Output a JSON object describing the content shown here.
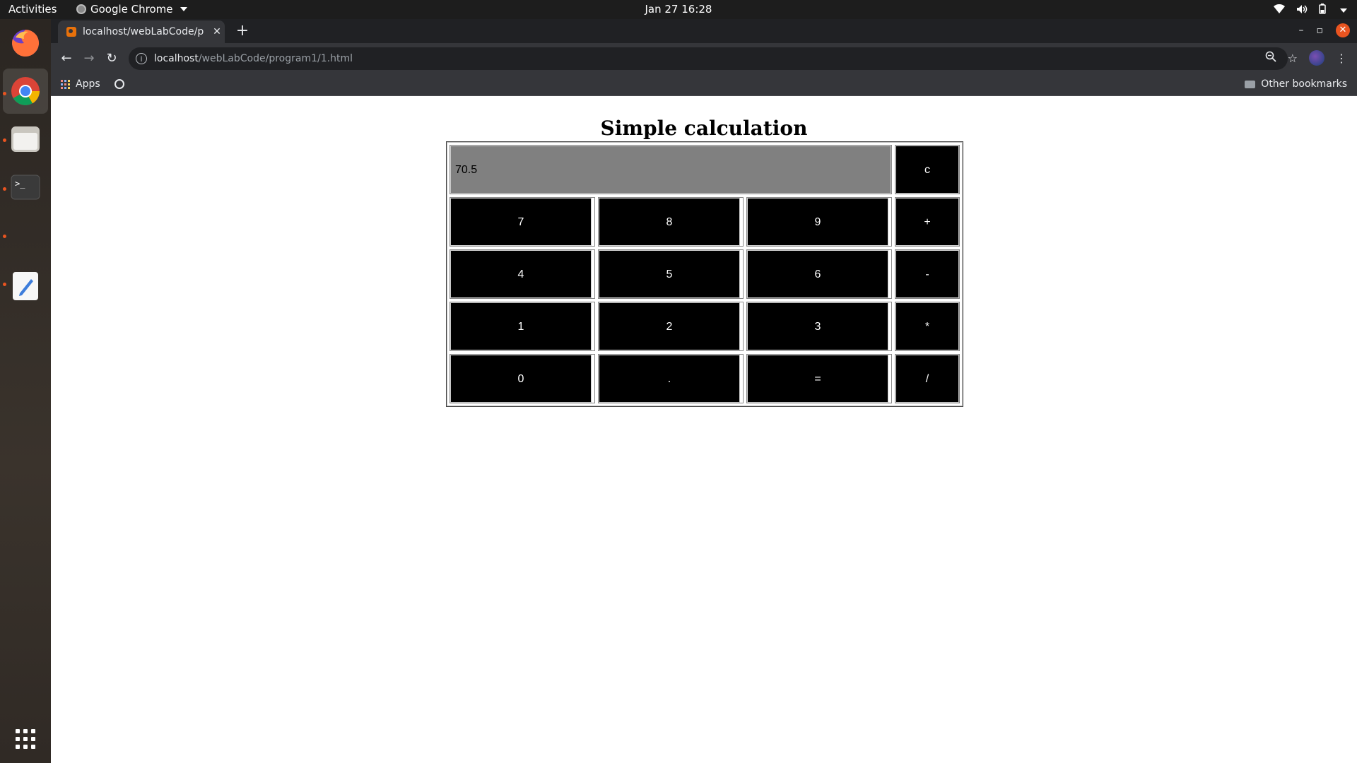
{
  "topbar": {
    "activities": "Activities",
    "app_name": "Google Chrome",
    "clock": "Jan 27  16:28"
  },
  "dock": {
    "items": [
      "firefox-icon",
      "chrome-icon",
      "files-icon",
      "terminal-icon",
      "text-editor-icon",
      "show-apps-icon"
    ]
  },
  "browser": {
    "tab_title": "localhost/webLabCode/p",
    "url_host": "localhost",
    "url_path": "/webLabCode/program1/1.html",
    "bookmarks": {
      "apps_label": "Apps",
      "other_label": "Other bookmarks"
    }
  },
  "page": {
    "title": "Simple calculation",
    "display_value": "70.5",
    "buttons": {
      "clear": "c",
      "row1": [
        "7",
        "8",
        "9",
        "+"
      ],
      "row2": [
        "4",
        "5",
        "6",
        "-"
      ],
      "row3": [
        "1",
        "2",
        "3",
        "*"
      ],
      "row4": [
        "0",
        ".",
        "=",
        "/"
      ]
    }
  },
  "colors": {
    "display_bg": "#808080",
    "button_bg": "#000000",
    "button_text": "#ffffff",
    "ubuntu_accent": "#e95420"
  }
}
